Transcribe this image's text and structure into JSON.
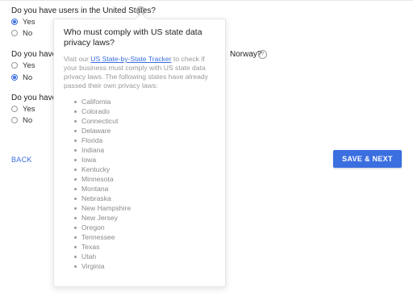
{
  "questions": [
    {
      "text": "Do you have users in the United States?",
      "options": [
        "Yes",
        "No"
      ],
      "selected": "Yes"
    },
    {
      "text_start": "Do you have u",
      "text_end": "Norway?",
      "options": [
        "Yes",
        "No"
      ],
      "selected": "No"
    },
    {
      "text_start": "Do you have u",
      "options": [
        "Yes",
        "No"
      ],
      "selected": null
    }
  ],
  "help_icon": "question-mark-circle-icon",
  "actions": {
    "back": "BACK",
    "save_next": "SAVE & NEXT"
  },
  "popover": {
    "title": "Who must comply with US state data privacy laws?",
    "body_prefix": "Visit our ",
    "link_text": "US State-by-State Tracker",
    "body_suffix": " to check if your business must comply with US state data privacy laws. The following states have already passed their own privacy laws:",
    "states": [
      "California",
      "Colorado",
      "Connecticut",
      "Delaware",
      "Florida",
      "Indiana",
      "Iowa",
      "Kentucky",
      "Minnesota",
      "Montana",
      "Nebraska",
      "New Hampshire",
      "New Jersey",
      "Oregon",
      "Tennessee",
      "Texas",
      "Utah",
      "Virginia"
    ]
  },
  "colors": {
    "accent": "#3b6fe0"
  }
}
